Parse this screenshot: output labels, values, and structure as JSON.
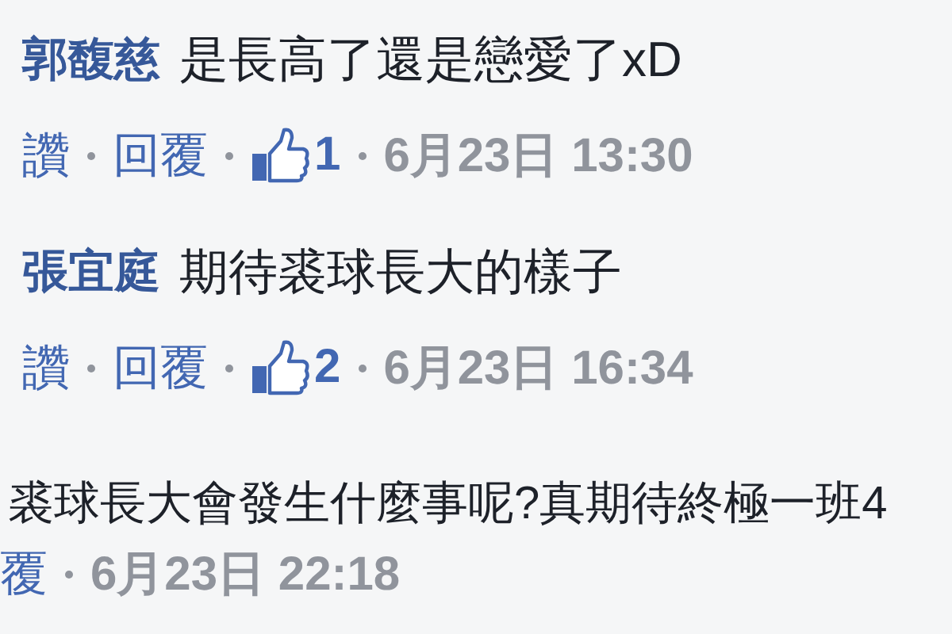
{
  "comments": [
    {
      "kind": "full",
      "author": "郭馥慈",
      "text": "是長高了還是戀愛了xD",
      "like_label": "讚",
      "reply_label": "回覆",
      "like_count": "1",
      "time": "6月23日 13:30"
    },
    {
      "kind": "full",
      "author": "張宜庭",
      "text": "期待裘球長大的樣子",
      "like_label": "讚",
      "reply_label": "回覆",
      "like_count": "2",
      "time": "6月23日 16:34"
    },
    {
      "kind": "partial",
      "text": "裘球長大會發生什麼事呢?真期待終極一班4",
      "reply_label": "覆",
      "time": "6月23日 22:18"
    }
  ]
}
